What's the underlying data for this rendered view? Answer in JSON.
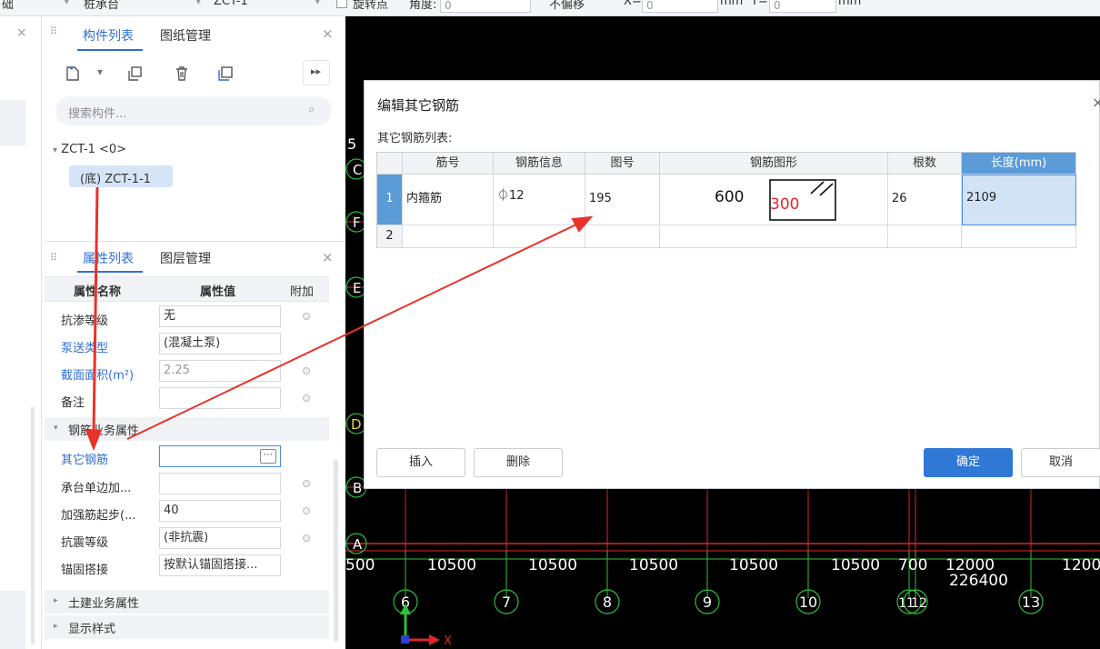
{
  "toolbar": {
    "item1": "础",
    "item2": "桩承台",
    "item3": "ZCT-1",
    "rotate_label": "旋转点",
    "angle_label": "角度:",
    "angle_value": "0",
    "offset_mode": "不偏移",
    "x_label": "X=",
    "x_value": "0",
    "unit1": "mm",
    "y_label": "Y=",
    "y_value": "0",
    "unit2": "mm"
  },
  "component_panel": {
    "tab_list": "构件列表",
    "tab_drawings": "图纸管理",
    "search_placeholder": "搜索构件...",
    "tree_root": "ZCT-1 <0>",
    "tree_child": "(底) ZCT-1-1"
  },
  "properties_panel": {
    "tab_props": "属性列表",
    "tab_layers": "图层管理",
    "headers": [
      "属性名称",
      "属性值",
      "附加"
    ],
    "rows_top": [
      {
        "name": "抗渗等级",
        "value": "无"
      },
      {
        "name": "泵送类型",
        "value": "(混凝土泵)"
      },
      {
        "name": "截面面积(m²)",
        "value": "2.25"
      },
      {
        "name": "备注",
        "value": ""
      }
    ],
    "group_rebar": "钢筋业务属性",
    "rows_rebar": [
      {
        "name": "其它钢筋",
        "value": ""
      },
      {
        "name": "承台单边加...",
        "value": ""
      },
      {
        "name": "加强筋起步(...",
        "value": "40"
      },
      {
        "name": "抗震等级",
        "value": "(非抗震)"
      },
      {
        "name": "锚固搭接",
        "value": "按默认锚固搭接..."
      }
    ],
    "group_civil": "土建业务属性",
    "group_display": "显示样式"
  },
  "dialog": {
    "title": "编辑其它钢筋",
    "close": "×",
    "subtitle": "其它钢筋列表:",
    "columns": [
      "筋号",
      "钢筋信息",
      "图号",
      "钢筋图形",
      "根数",
      "长度(mm)"
    ],
    "rows": [
      {
        "index": "1",
        "bar_no": "内箍筋",
        "rebar_info": "⏀12",
        "shape_no": "195",
        "shape_dim1": "600",
        "shape_dim2": "300",
        "count": "26",
        "length": "2109"
      },
      {
        "index": "2",
        "bar_no": "",
        "rebar_info": "",
        "shape_no": "",
        "shape_dim1": "",
        "shape_dim2": "",
        "count": "",
        "length": ""
      }
    ],
    "btn_insert": "插入",
    "btn_delete": "删除",
    "btn_ok": "确定",
    "btn_cancel": "取消"
  },
  "cad": {
    "row_labels": [
      "5",
      "C",
      "F",
      "E",
      "D",
      "B",
      "A"
    ],
    "dimensions": [
      "500",
      "10500",
      "10500",
      "10500",
      "10500",
      "10500",
      "700",
      "12000",
      "1200"
    ],
    "total_dimension": "226400",
    "axis_numbers": [
      "6",
      "7",
      "8",
      "9",
      "10",
      "11",
      "12",
      "13"
    ],
    "axis_x": "X"
  },
  "colors": {
    "accent": "#2f6fd6",
    "arrow": "#e8322a",
    "cad_red": "#e0262a",
    "cad_green": "#2fbf3a"
  }
}
